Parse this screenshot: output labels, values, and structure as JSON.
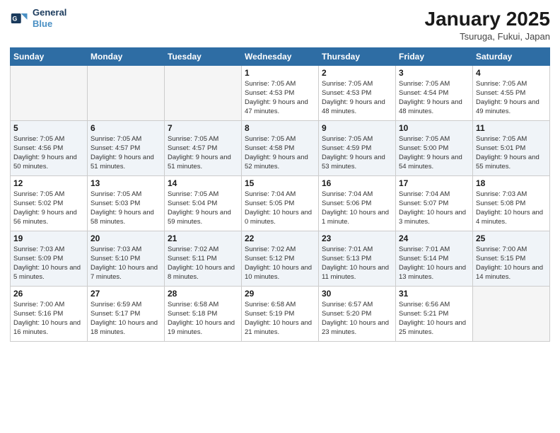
{
  "header": {
    "logo_line1": "General",
    "logo_line2": "Blue",
    "title": "January 2025",
    "subtitle": "Tsuruga, Fukui, Japan"
  },
  "weekdays": [
    "Sunday",
    "Monday",
    "Tuesday",
    "Wednesday",
    "Thursday",
    "Friday",
    "Saturday"
  ],
  "weeks": [
    [
      {
        "num": "",
        "info": ""
      },
      {
        "num": "",
        "info": ""
      },
      {
        "num": "",
        "info": ""
      },
      {
        "num": "1",
        "info": "Sunrise: 7:05 AM\nSunset: 4:53 PM\nDaylight: 9 hours and 47 minutes."
      },
      {
        "num": "2",
        "info": "Sunrise: 7:05 AM\nSunset: 4:53 PM\nDaylight: 9 hours and 48 minutes."
      },
      {
        "num": "3",
        "info": "Sunrise: 7:05 AM\nSunset: 4:54 PM\nDaylight: 9 hours and 48 minutes."
      },
      {
        "num": "4",
        "info": "Sunrise: 7:05 AM\nSunset: 4:55 PM\nDaylight: 9 hours and 49 minutes."
      }
    ],
    [
      {
        "num": "5",
        "info": "Sunrise: 7:05 AM\nSunset: 4:56 PM\nDaylight: 9 hours and 50 minutes."
      },
      {
        "num": "6",
        "info": "Sunrise: 7:05 AM\nSunset: 4:57 PM\nDaylight: 9 hours and 51 minutes."
      },
      {
        "num": "7",
        "info": "Sunrise: 7:05 AM\nSunset: 4:57 PM\nDaylight: 9 hours and 51 minutes."
      },
      {
        "num": "8",
        "info": "Sunrise: 7:05 AM\nSunset: 4:58 PM\nDaylight: 9 hours and 52 minutes."
      },
      {
        "num": "9",
        "info": "Sunrise: 7:05 AM\nSunset: 4:59 PM\nDaylight: 9 hours and 53 minutes."
      },
      {
        "num": "10",
        "info": "Sunrise: 7:05 AM\nSunset: 5:00 PM\nDaylight: 9 hours and 54 minutes."
      },
      {
        "num": "11",
        "info": "Sunrise: 7:05 AM\nSunset: 5:01 PM\nDaylight: 9 hours and 55 minutes."
      }
    ],
    [
      {
        "num": "12",
        "info": "Sunrise: 7:05 AM\nSunset: 5:02 PM\nDaylight: 9 hours and 56 minutes."
      },
      {
        "num": "13",
        "info": "Sunrise: 7:05 AM\nSunset: 5:03 PM\nDaylight: 9 hours and 58 minutes."
      },
      {
        "num": "14",
        "info": "Sunrise: 7:05 AM\nSunset: 5:04 PM\nDaylight: 9 hours and 59 minutes."
      },
      {
        "num": "15",
        "info": "Sunrise: 7:04 AM\nSunset: 5:05 PM\nDaylight: 10 hours and 0 minutes."
      },
      {
        "num": "16",
        "info": "Sunrise: 7:04 AM\nSunset: 5:06 PM\nDaylight: 10 hours and 1 minute."
      },
      {
        "num": "17",
        "info": "Sunrise: 7:04 AM\nSunset: 5:07 PM\nDaylight: 10 hours and 3 minutes."
      },
      {
        "num": "18",
        "info": "Sunrise: 7:03 AM\nSunset: 5:08 PM\nDaylight: 10 hours and 4 minutes."
      }
    ],
    [
      {
        "num": "19",
        "info": "Sunrise: 7:03 AM\nSunset: 5:09 PM\nDaylight: 10 hours and 5 minutes."
      },
      {
        "num": "20",
        "info": "Sunrise: 7:03 AM\nSunset: 5:10 PM\nDaylight: 10 hours and 7 minutes."
      },
      {
        "num": "21",
        "info": "Sunrise: 7:02 AM\nSunset: 5:11 PM\nDaylight: 10 hours and 8 minutes."
      },
      {
        "num": "22",
        "info": "Sunrise: 7:02 AM\nSunset: 5:12 PM\nDaylight: 10 hours and 10 minutes."
      },
      {
        "num": "23",
        "info": "Sunrise: 7:01 AM\nSunset: 5:13 PM\nDaylight: 10 hours and 11 minutes."
      },
      {
        "num": "24",
        "info": "Sunrise: 7:01 AM\nSunset: 5:14 PM\nDaylight: 10 hours and 13 minutes."
      },
      {
        "num": "25",
        "info": "Sunrise: 7:00 AM\nSunset: 5:15 PM\nDaylight: 10 hours and 14 minutes."
      }
    ],
    [
      {
        "num": "26",
        "info": "Sunrise: 7:00 AM\nSunset: 5:16 PM\nDaylight: 10 hours and 16 minutes."
      },
      {
        "num": "27",
        "info": "Sunrise: 6:59 AM\nSunset: 5:17 PM\nDaylight: 10 hours and 18 minutes."
      },
      {
        "num": "28",
        "info": "Sunrise: 6:58 AM\nSunset: 5:18 PM\nDaylight: 10 hours and 19 minutes."
      },
      {
        "num": "29",
        "info": "Sunrise: 6:58 AM\nSunset: 5:19 PM\nDaylight: 10 hours and 21 minutes."
      },
      {
        "num": "30",
        "info": "Sunrise: 6:57 AM\nSunset: 5:20 PM\nDaylight: 10 hours and 23 minutes."
      },
      {
        "num": "31",
        "info": "Sunrise: 6:56 AM\nSunset: 5:21 PM\nDaylight: 10 hours and 25 minutes."
      },
      {
        "num": "",
        "info": ""
      }
    ]
  ]
}
